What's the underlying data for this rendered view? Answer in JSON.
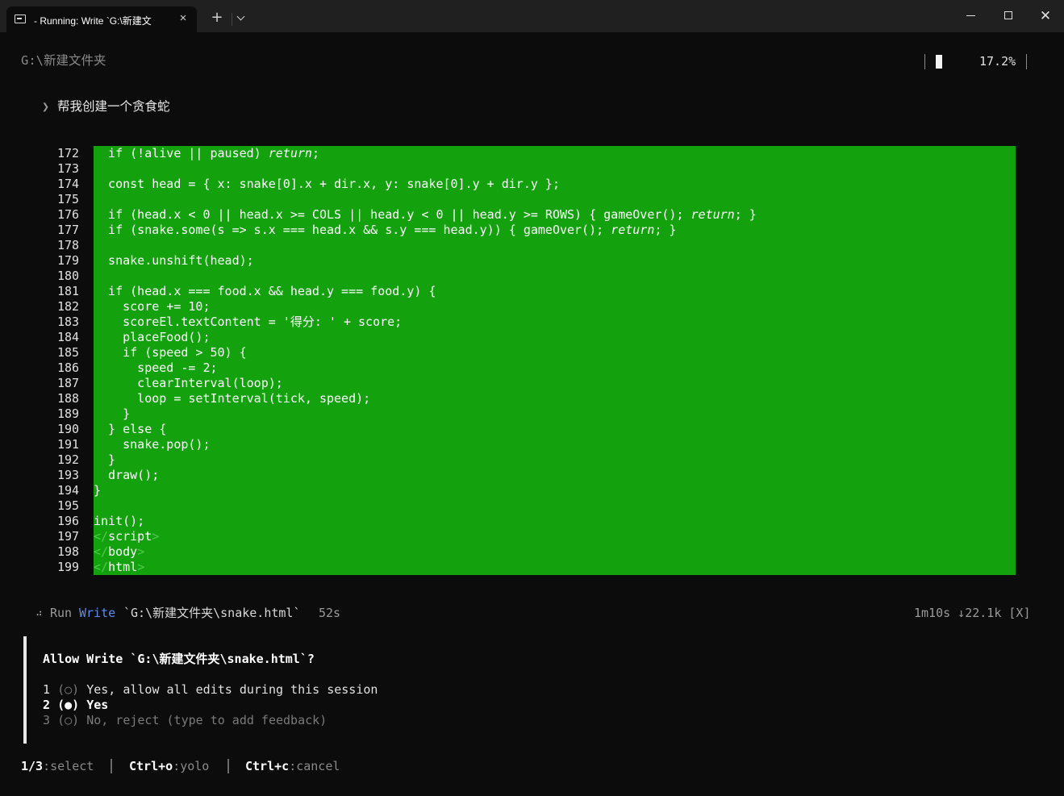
{
  "window": {
    "tab_title": "- Running: Write `G:\\新建文",
    "tab_close_icon": "×",
    "new_tab_icon": "+",
    "close_icon": "✕"
  },
  "header": {
    "directory": "G:\\新建文件夹",
    "progress_text": "17.2%",
    "progress_fraction": 0.172
  },
  "prompt": {
    "arrow": "❯",
    "text": "帮我创建一个贪食蛇"
  },
  "code": {
    "highlight_color": "#13a10e",
    "lines": [
      {
        "n": "172",
        "html": "  if (!alive || paused) <i>return</i>;"
      },
      {
        "n": "173",
        "html": ""
      },
      {
        "n": "174",
        "html": "  const head = { x: snake[0].x + dir.x, y: snake[0].y + dir.y };"
      },
      {
        "n": "175",
        "html": ""
      },
      {
        "n": "176",
        "html": "  if (head.x &lt; 0 || head.x &gt;= COLS || head.y &lt; 0 || head.y &gt;= ROWS) { gameOver(); <i>return</i>; }"
      },
      {
        "n": "177",
        "html": "  if (snake.some(s =&gt; s.x === head.x &amp;&amp; s.y === head.y)) { gameOver(); <i>return</i>; }"
      },
      {
        "n": "178",
        "html": ""
      },
      {
        "n": "179",
        "html": "  snake.unshift(head);"
      },
      {
        "n": "180",
        "html": ""
      },
      {
        "n": "181",
        "html": "  if (head.x === food.x &amp;&amp; head.y === food.y) {"
      },
      {
        "n": "182",
        "html": "    score += 10;"
      },
      {
        "n": "183",
        "html": "    scoreEl.textContent = '得分: ' + score;"
      },
      {
        "n": "184",
        "html": "    placeFood();"
      },
      {
        "n": "185",
        "html": "    if (speed &gt; 50) {"
      },
      {
        "n": "186",
        "html": "      speed -= 2;"
      },
      {
        "n": "187",
        "html": "      clearInterval(loop);"
      },
      {
        "n": "188",
        "html": "      loop = setInterval(tick, speed);"
      },
      {
        "n": "189",
        "html": "    }"
      },
      {
        "n": "190",
        "html": "  } else {"
      },
      {
        "n": "191",
        "html": "    snake.pop();"
      },
      {
        "n": "192",
        "html": "  }"
      },
      {
        "n": "193",
        "html": "  draw();"
      },
      {
        "n": "194",
        "html": "}"
      },
      {
        "n": "195",
        "html": ""
      },
      {
        "n": "196",
        "html": "init();"
      },
      {
        "n": "197",
        "html": "<span class=\"dim\">&lt;/</span>script<span class=\"dim\">&gt;</span>"
      },
      {
        "n": "198",
        "html": "<span class=\"dim\">&lt;/</span>body<span class=\"dim\">&gt;</span>"
      },
      {
        "n": "199",
        "html": "<span class=\"dim\">&lt;/</span>html<span class=\"dim\">&gt;</span>"
      }
    ]
  },
  "status": {
    "icon": "⠴",
    "run": "Run",
    "tool": "Write",
    "path": "`G:\\新建文件夹\\snake.html`",
    "elapsed": "52s",
    "stats": "1m10s ↓22.1k [X]"
  },
  "permission": {
    "question": "Allow Write `G:\\新建文件夹\\snake.html`?",
    "options": [
      {
        "num": "1",
        "radio": "(○)",
        "label": "Yes, allow all edits during this session"
      },
      {
        "num": "2",
        "radio": "(●)",
        "label": "Yes"
      },
      {
        "num": "3",
        "radio": "(○)",
        "label": "No, reject (type to add feedback)"
      }
    ]
  },
  "footer": {
    "hints": [
      {
        "key": "1/3",
        "action": ":select"
      },
      {
        "key": "Ctrl+o",
        "action": ":yolo"
      },
      {
        "key": "Ctrl+c",
        "action": ":cancel"
      }
    ]
  }
}
